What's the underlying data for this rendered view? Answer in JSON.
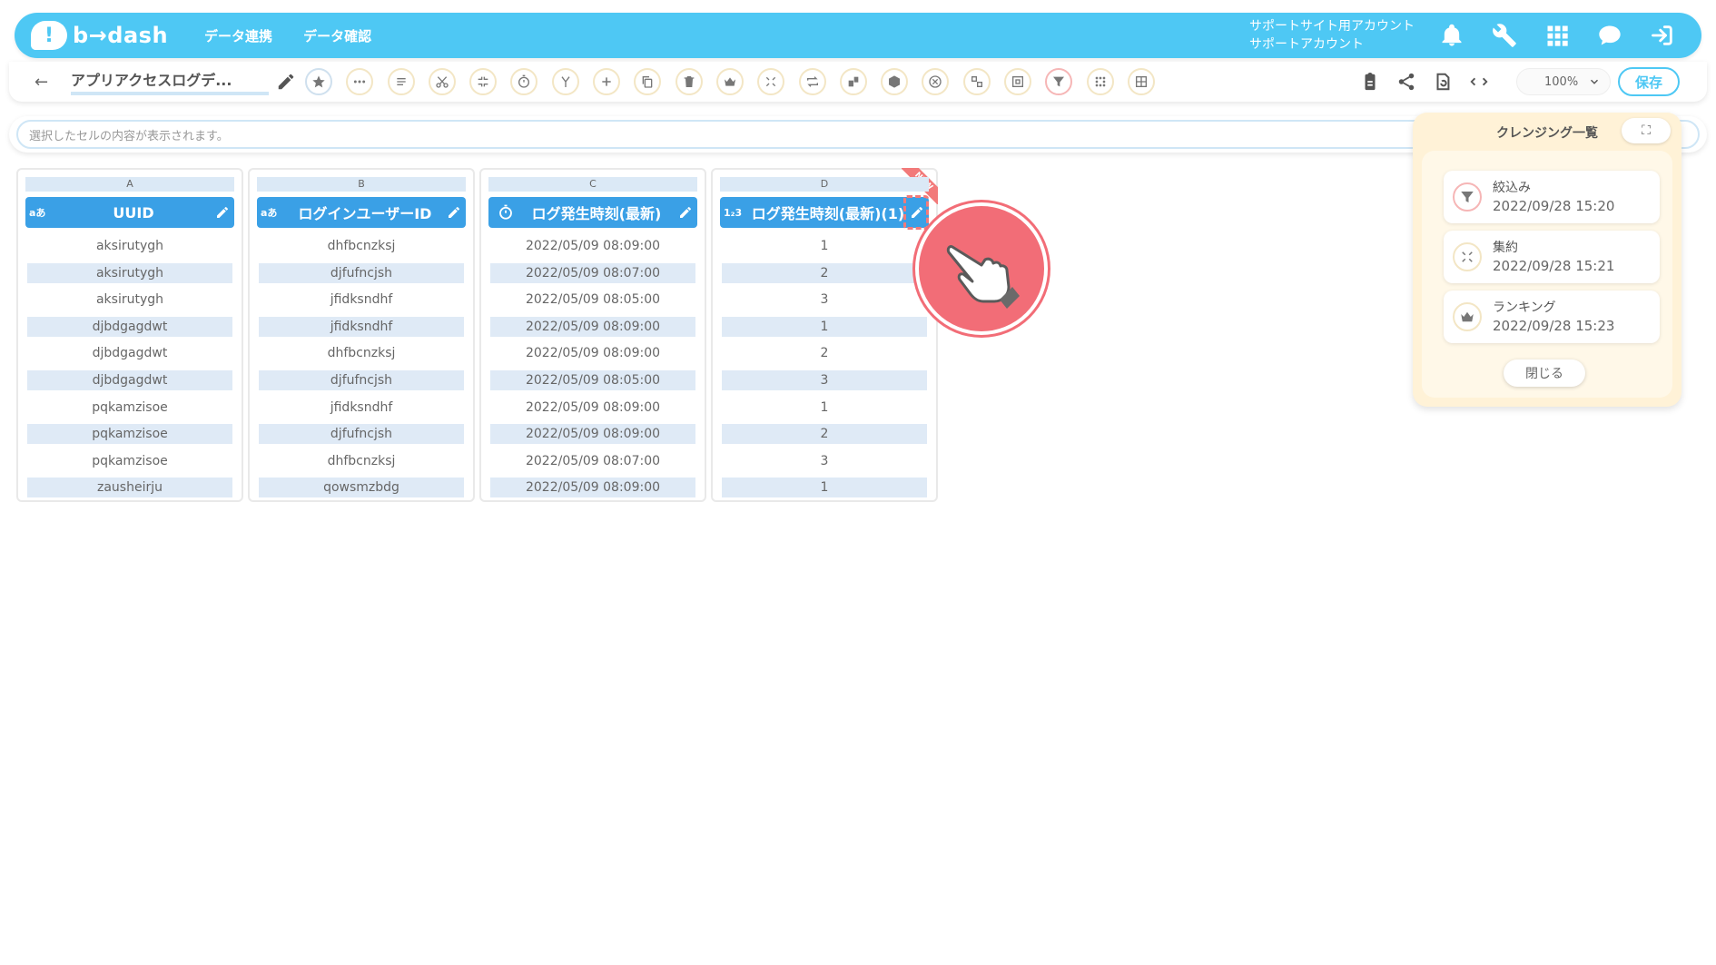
{
  "header": {
    "logo_text": "b→dash",
    "nav": [
      "データ連携",
      "データ確認"
    ],
    "account_line1": "サポートサイト用アカウント",
    "account_line2": "サポートアカウント"
  },
  "toolbar": {
    "back_glyph": "←",
    "title": "アプリアクセスログデ...",
    "zoom": "100%",
    "save_label": "保存"
  },
  "cellbar": {
    "placeholder": "選択したセルの内容が表示されます。"
  },
  "columns": [
    {
      "letter": "A",
      "type": "aあ",
      "name": "UUID",
      "rows": [
        "aksirutygh",
        "aksirutygh",
        "aksirutygh",
        "djbdgagdwt",
        "djbdgagdwt",
        "djbdgagdwt",
        "pqkamzisoe",
        "pqkamzisoe",
        "pqkamzisoe",
        "zausheirju"
      ]
    },
    {
      "letter": "B",
      "type": "aあ",
      "name": "ログインユーザーID",
      "rows": [
        "dhfbcnzksj",
        "djfufncjsh",
        "jfidksndhf",
        "jfidksndhf",
        "dhfbcnzksj",
        "djfufncjsh",
        "jfidksndhf",
        "djfufncjsh",
        "dhfbcnzksj",
        "qowsmzbdg"
      ]
    },
    {
      "letter": "C",
      "type": "clock-icon",
      "name": "ログ発生時刻(最新)",
      "rows": [
        "2022/05/09 08:09:00",
        "2022/05/09 08:07:00",
        "2022/05/09 08:05:00",
        "2022/05/09 08:09:00",
        "2022/05/09 08:09:00",
        "2022/05/09 08:05:00",
        "2022/05/09 08:09:00",
        "2022/05/09 08:09:00",
        "2022/05/09 08:07:00",
        "2022/05/09 08:09:00"
      ]
    },
    {
      "letter": "D",
      "type": "1₂3",
      "name": "ログ発生時刻(最新)(1)",
      "badge": "NEW",
      "rows": [
        "1",
        "2",
        "3",
        "1",
        "2",
        "3",
        "1",
        "2",
        "3",
        "1"
      ]
    }
  ],
  "panel": {
    "title": "クレンジング一覧",
    "expand_glyph": "⛶",
    "items": [
      {
        "label": "絞込み",
        "date": "2022/09/28 15:20",
        "icon": "filter-icon"
      },
      {
        "label": "集約",
        "date": "2022/09/28 15:21",
        "icon": "aggregate-icon"
      },
      {
        "label": "ランキング",
        "date": "2022/09/28 15:23",
        "icon": "crown-icon"
      }
    ],
    "close_label": "閉じる"
  },
  "colors": {
    "header_bg": "#4ec8f4",
    "column_header": "#3aa0e6",
    "row_alt": "#dfeaf6",
    "panel_bg": "#fff2d7",
    "pointer": "#f26d77"
  }
}
